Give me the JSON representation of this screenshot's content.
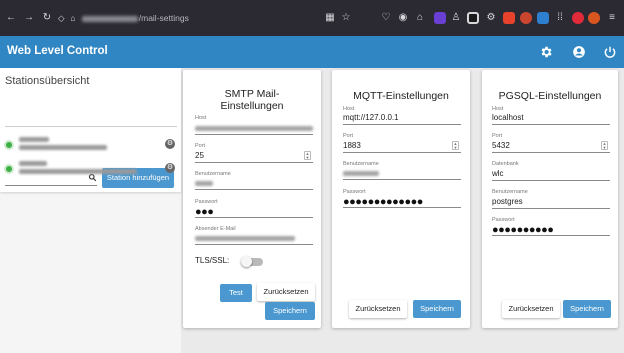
{
  "browser": {
    "url_suffix": "/mail-settings",
    "back_icon": "back-arrow-icon",
    "forward_icon": "forward-arrow-icon",
    "reload_icon": "reload-icon"
  },
  "app": {
    "title": "Web Level Control",
    "header_color": "#2f86c2"
  },
  "sidebar": {
    "title": "Stationsübersicht",
    "add_button": "Station hinzufügen",
    "search_placeholder": "",
    "stations": [
      {
        "status": "online",
        "status_color": "#3cb043"
      },
      {
        "status": "online",
        "status_color": "#3cb043"
      }
    ]
  },
  "smtp": {
    "title_line1": "SMTP Mail-",
    "title_line2": "Einstellungen",
    "host_label": "Host",
    "port_label": "Port",
    "port_value": "25",
    "user_label": "Benutzername",
    "password_label": "Passwort",
    "password_value": "●●●",
    "sender_label": "Absender E-Mail",
    "tls_label": "TLS/SSL:",
    "tls_enabled": false,
    "test_button": "Test",
    "reset_button": "Zurücksetzen",
    "save_button": "Speichern"
  },
  "mqtt": {
    "title": "MQTT-Einstellungen",
    "host_label": "Host",
    "host_value": "mqtt://127.0.0.1",
    "port_label": "Port",
    "port_value": "1883",
    "user_label": "Benutzername",
    "password_label": "Passwort",
    "password_value": "●●●●●●●●●●●●●",
    "reset_button": "Zurücksetzen",
    "save_button": "Speichern"
  },
  "pgsql": {
    "title": "PGSQL-Einstellungen",
    "host_label": "Host",
    "host_value": "localhost",
    "port_label": "Port",
    "port_value": "5432",
    "db_label": "Datenbank",
    "db_value": "wlc",
    "user_label": "Benutzername",
    "user_value": "postgres",
    "password_label": "Passwort",
    "password_value": "●●●●●●●●●●",
    "reset_button": "Zurücksetzen",
    "save_button": "Speichern"
  }
}
